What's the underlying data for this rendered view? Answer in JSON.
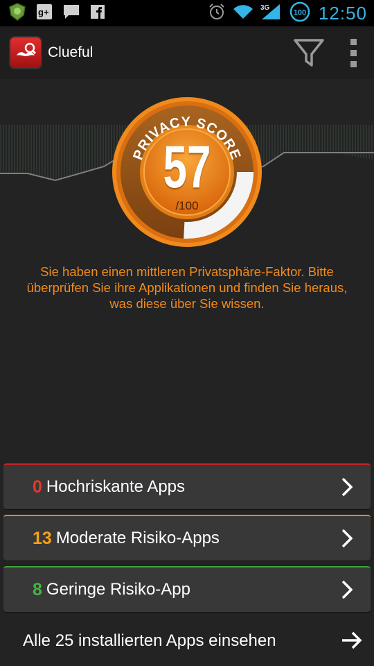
{
  "status_bar": {
    "time": "12:50",
    "battery_level": "100",
    "network_type": "3G",
    "icons": [
      "shield-icon",
      "google-plus-icon",
      "chat-icon",
      "facebook-icon",
      "alarm-icon",
      "wifi-icon",
      "signal-icon",
      "battery-icon"
    ]
  },
  "action_bar": {
    "title": "Clueful",
    "icons": [
      "clueful-app-icon",
      "filter-icon",
      "overflow-menu-icon"
    ]
  },
  "score": {
    "badge_text": "PRIVACY SCORE",
    "value": "57",
    "max": "/100",
    "fraction": 0.57
  },
  "description": "Sie haben einen mittleren Privatsphäre-Faktor. Bitte überprüfen Sie ihre Applikationen und finden Sie heraus, was diese über Sie wissen.",
  "categories": [
    {
      "count": "0",
      "label": "Hochriskante Apps",
      "color": "#e03a2c"
    },
    {
      "count": "13",
      "label": "Moderate Risiko-Apps",
      "color": "#f5a21b"
    },
    {
      "count": "8",
      "label": "Geringe Risiko-App",
      "color": "#3fb83f"
    }
  ],
  "all_apps": {
    "label": "Alle 25 installierten Apps einsehen"
  },
  "colors": {
    "accent_blue": "#33b5e5",
    "score_orange": "#f28a1a"
  }
}
